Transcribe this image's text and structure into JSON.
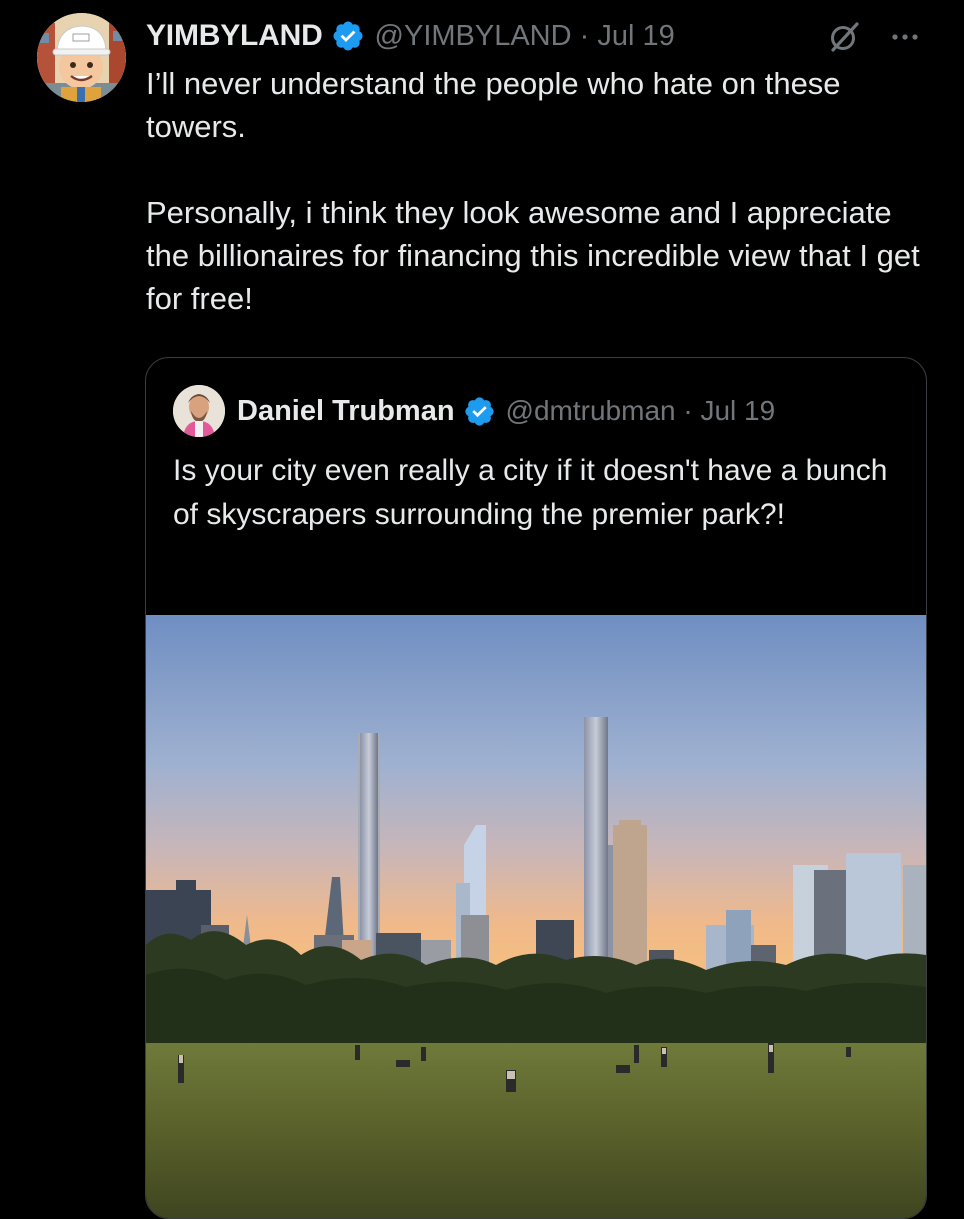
{
  "tweet": {
    "author_name": "YIMBYLAND",
    "author_handle_date": "@YIMBYLAND · Jul 19",
    "text": "I’ll never understand the people who hate on these towers.\n\nPersonally, i think they look awesome and I appreciate the billionaires for financing this incredible view that I get for free!",
    "icons": {
      "avatar": "cartoon-builder-avatar",
      "verified": "verified-badge-icon",
      "grok": "grok-icon",
      "more": "more-options-icon"
    }
  },
  "quoted_tweet": {
    "author_name": "Daniel Trubman",
    "author_handle_date": "@dmtrubman · Jul 19",
    "text": "Is your city even really a city if it doesn't have a bunch of skyscrapers surrounding the premier park?!",
    "media": "photo of skyscrapers over a park lawn at sunset"
  },
  "colors": {
    "background": "#000000",
    "text_primary": "#e7e9ea",
    "text_secondary": "#71767b",
    "verified_blue": "#1d9bf0",
    "border": "#3a3e42"
  }
}
